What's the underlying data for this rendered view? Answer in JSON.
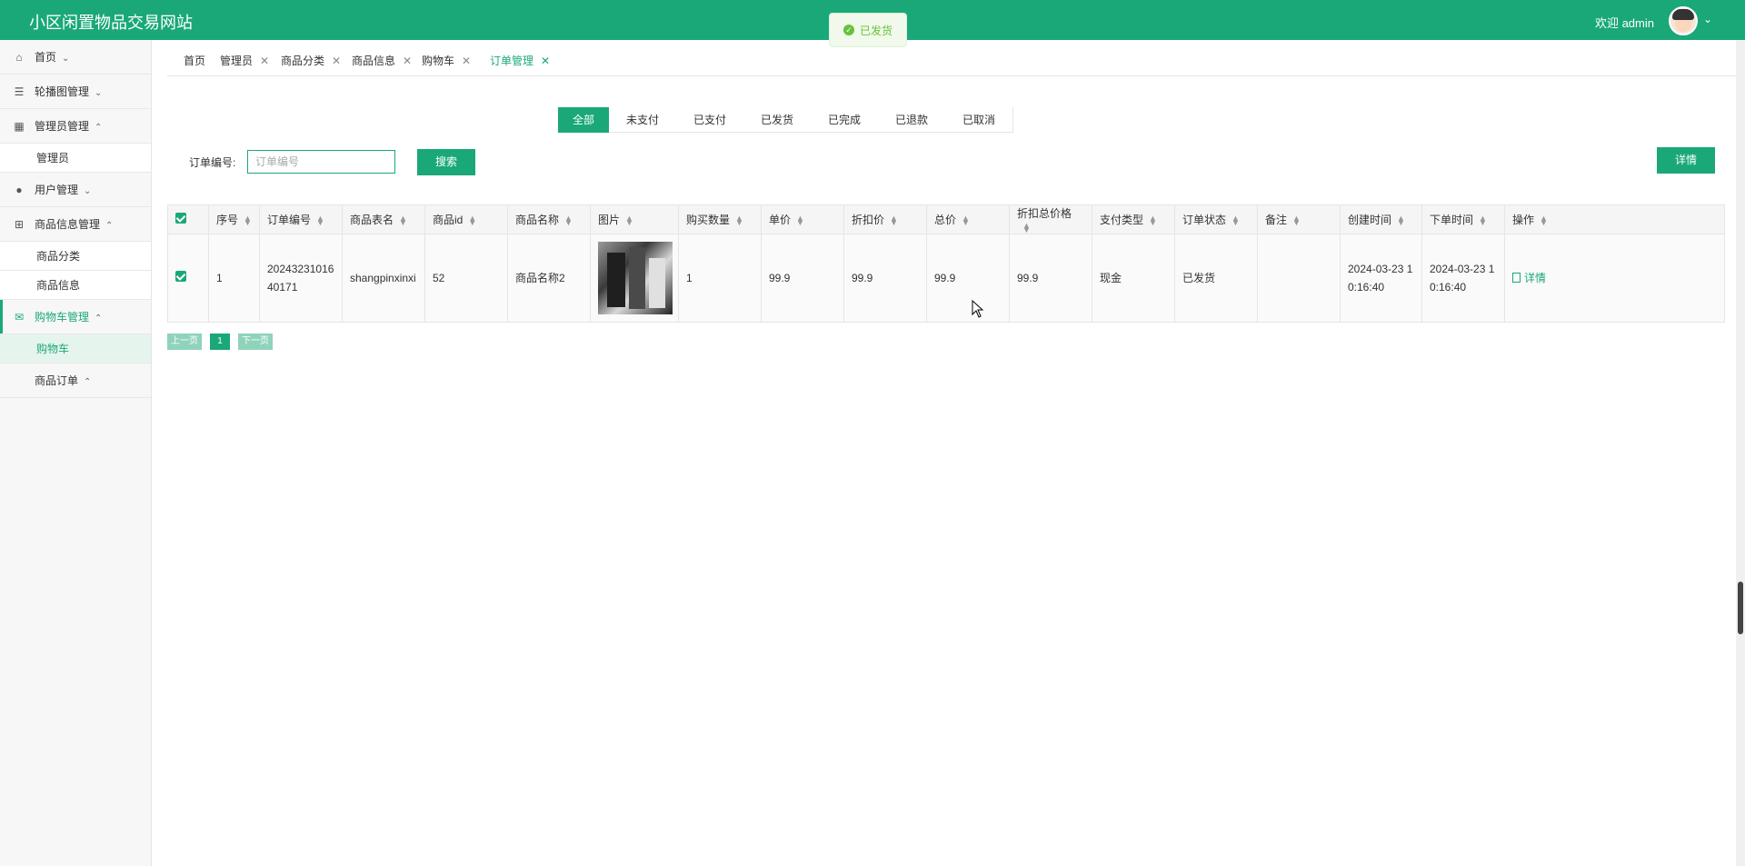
{
  "header": {
    "title": "小区闲置物品交易网站",
    "welcome": "欢迎 admin"
  },
  "toast": {
    "text": "已发货"
  },
  "sidebar": {
    "items": [
      {
        "label": "首页",
        "icon": "home-icon",
        "arrow": "⌄"
      },
      {
        "label": "轮播图管理",
        "icon": "list-icon",
        "arrow": "⌄"
      },
      {
        "label": "管理员管理",
        "icon": "dashboard-icon",
        "arrow": "⌃",
        "children": [
          "管理员"
        ]
      },
      {
        "label": "用户管理",
        "icon": "user-icon",
        "arrow": "⌄"
      },
      {
        "label": "商品信息管理",
        "icon": "grid-icon",
        "arrow": "⌃",
        "children": [
          "商品分类",
          "商品信息"
        ]
      },
      {
        "label": "购物车管理",
        "icon": "mail-icon",
        "arrow": "⌃",
        "children": [
          "购物车"
        ]
      },
      {
        "label": "商品订单",
        "arrow": "⌃"
      }
    ]
  },
  "tabs": [
    {
      "label": "首页",
      "closable": false
    },
    {
      "label": "管理员",
      "closable": true
    },
    {
      "label": "商品分类",
      "closable": true
    },
    {
      "label": "商品信息",
      "closable": true
    },
    {
      "label": "购物车",
      "closable": true
    },
    {
      "label": "订单管理",
      "closable": true,
      "active": true
    }
  ],
  "status_filters": [
    "全部",
    "未支付",
    "已支付",
    "已发货",
    "已完成",
    "已退款",
    "已取消"
  ],
  "search": {
    "label": "订单编号:",
    "placeholder": "订单编号",
    "button": "搜索"
  },
  "detail_button": "详情",
  "table": {
    "headers": [
      "序号",
      "订单编号",
      "商品表名",
      "商品id",
      "商品名称",
      "图片",
      "购买数量",
      "单价",
      "折扣价",
      "总价",
      "折扣总价格",
      "支付类型",
      "订单状态",
      "备注",
      "创建时间",
      "下单时间",
      "操作"
    ],
    "rows": [
      {
        "index": "1",
        "order_no": "2024323101640171",
        "table_name": "shangpinxinxi",
        "goods_id": "52",
        "goods_name": "商品名称2",
        "quantity": "1",
        "price": "99.9",
        "discount_price": "99.9",
        "total": "99.9",
        "discount_total": "99.9",
        "pay_type": "现金",
        "status": "已发货",
        "remark": "",
        "created": "2024-03-23 10:16:40",
        "ordered": "2024-03-23 10:16:40",
        "action": "详情"
      }
    ]
  },
  "pagination": {
    "prev": "上一页",
    "current": "1",
    "next": "下一页"
  },
  "colors": {
    "brand": "#1aa879",
    "toast_bg": "#f0f9eb",
    "toast_text": "#67c23a"
  }
}
